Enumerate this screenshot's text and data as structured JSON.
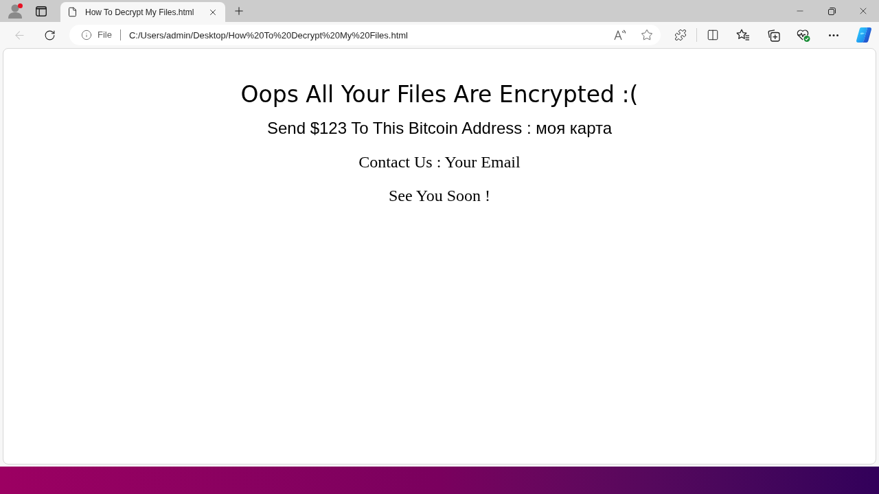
{
  "profile": {
    "notification": true
  },
  "tabs": [
    {
      "title": "How To Decrypt My Files.html",
      "selected": true
    }
  ],
  "toolbar": {
    "back_disabled": true
  },
  "address_bar": {
    "scheme": "File",
    "url": "C:/Users/admin/Desktop/How%20To%20Decrypt%20My%20Files.html"
  },
  "page": {
    "lines": [
      {
        "kind": "heading",
        "text": "Oops All Your Files Are Encrypted :("
      },
      {
        "kind": "sans",
        "text": "Send $123 To This Bitcoin Address : моя карта"
      },
      {
        "kind": "serif",
        "text": "Contact Us : Your Email"
      },
      {
        "kind": "serif",
        "text": "See You Soon !"
      }
    ]
  }
}
